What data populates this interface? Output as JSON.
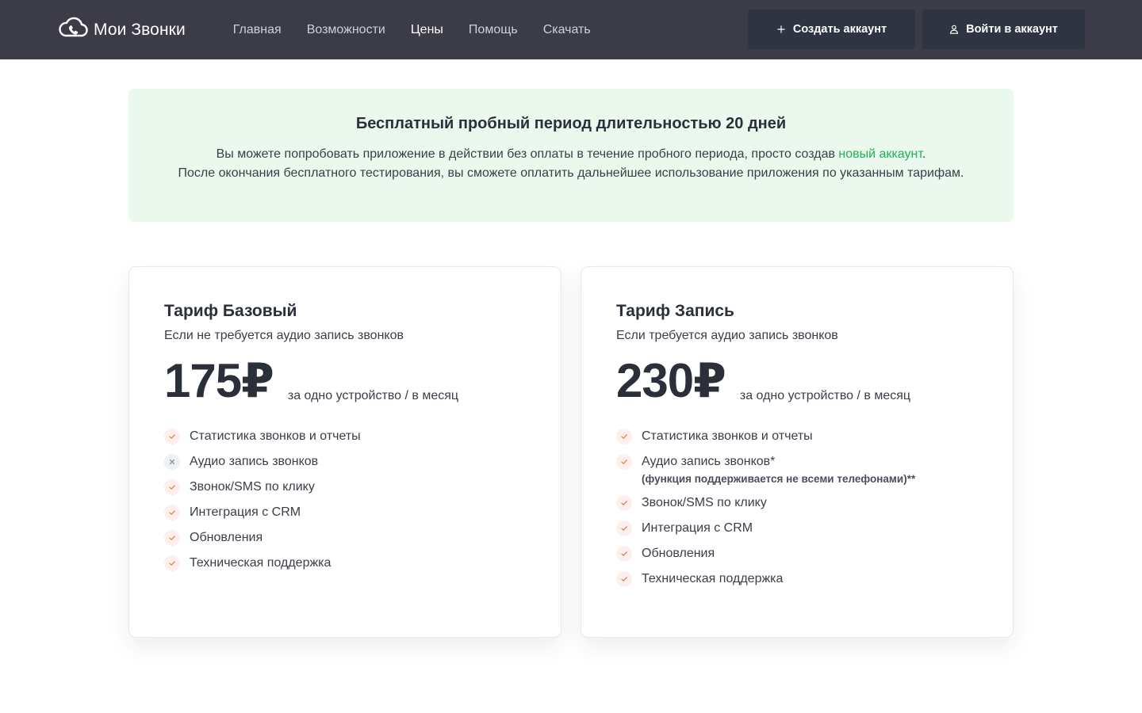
{
  "header": {
    "logo_text": "Мои Звонки",
    "nav": [
      {
        "label": "Главная",
        "active": false
      },
      {
        "label": "Возможности",
        "active": false
      },
      {
        "label": "Цены",
        "active": true
      },
      {
        "label": "Помощь",
        "active": false
      },
      {
        "label": "Скачать",
        "active": false
      }
    ],
    "create_account_label": "Создать аккаунт",
    "create_account_icon": "plus-icon",
    "login_label": "Войти в аккаунт",
    "login_icon": "user-icon"
  },
  "trial": {
    "title": "Бесплатный пробный период длительностью 20 дней",
    "line1_before": "Вы можете попробовать приложение в действии без оплаты в течение пробного периода, просто создав ",
    "line1_link": "новый аккаунт",
    "line1_after": ".",
    "line2": "После окончания бесплатного тестирования, вы сможете оплатить дальнейшее использование приложения по указанным тарифам.",
    "link_color": "#1fb355"
  },
  "plans": [
    {
      "title": "Тариф Базовый",
      "subtitle": "Если не требуется аудио запись звонков",
      "price": "175₽",
      "price_note": "за одно устройство / в месяц",
      "features": [
        {
          "text": "Статистика звонков и отчеты",
          "included": true
        },
        {
          "text": "Аудио запись звонков",
          "included": false
        },
        {
          "text": "Звонок/SMS по клику",
          "included": true
        },
        {
          "text": "Интеграция с CRM",
          "included": true
        },
        {
          "text": "Обновления",
          "included": true
        },
        {
          "text": "Техническая поддержка",
          "included": true
        }
      ]
    },
    {
      "title": "Тариф Запись",
      "subtitle": "Если требуется аудио запись звонков",
      "price": "230₽",
      "price_note": "за одно устройство / в месяц",
      "features": [
        {
          "text": "Статистика звонков и отчеты",
          "included": true
        },
        {
          "text": "Аудио запись звонков*",
          "included": true,
          "note": "(функция поддерживается не всеми телефонами)**"
        },
        {
          "text": "Звонок/SMS по клику",
          "included": true
        },
        {
          "text": "Интеграция с CRM",
          "included": true
        },
        {
          "text": "Обновления",
          "included": true
        },
        {
          "text": "Техническая поддержка",
          "included": true
        }
      ]
    }
  ],
  "colors": {
    "header_bg": "#3b3c48",
    "button_bg": "#2e3442",
    "banner_bg": "#ebf8ee",
    "check_color": "#e8795a",
    "cross_color": "#8a90a0"
  }
}
